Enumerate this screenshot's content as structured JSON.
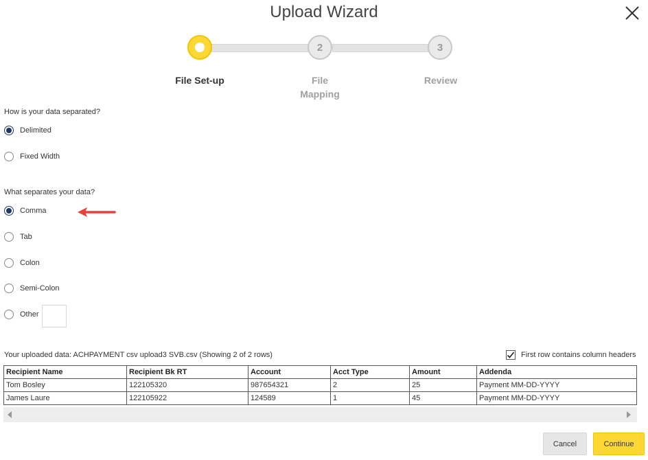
{
  "title": "Upload Wizard",
  "steps": [
    {
      "number": "",
      "label": "File Set-up",
      "state": "active"
    },
    {
      "number": "2",
      "label": "File\nMapping",
      "state": "inactive"
    },
    {
      "number": "3",
      "label": "Review",
      "state": "inactive"
    }
  ],
  "separation": {
    "question": "How is your data separated?",
    "options": [
      {
        "label": "Delimited",
        "selected": true
      },
      {
        "label": "Fixed Width",
        "selected": false
      }
    ]
  },
  "delimiter": {
    "question": "What separates your data?",
    "options": [
      {
        "label": "Comma",
        "selected": true
      },
      {
        "label": "Tab",
        "selected": false
      },
      {
        "label": "Colon",
        "selected": false
      },
      {
        "label": "Semi-Colon",
        "selected": false
      },
      {
        "label": "Other",
        "selected": false
      }
    ],
    "other_value": ""
  },
  "uploaded": {
    "prefix": "Your uploaded data:",
    "detail": "ACHPAYMENT csv upload3 SVB.csv (Showing 2 of 2 rows)",
    "header_checkbox_label": "First row contains column headers",
    "header_checkbox_checked": true
  },
  "table": {
    "columns": [
      "Recipient Name",
      "Recipient Bk RT",
      "Account",
      "Acct Type",
      "Amount",
      "Addenda"
    ],
    "rows": [
      [
        "Tom Bosley",
        "122105320",
        "987654321",
        "2",
        "25",
        "Payment MM-DD-YYYY"
      ],
      [
        "James Laure",
        "122105922",
        "124589",
        "1",
        "45",
        "Payment MM-DD-YYYY"
      ]
    ]
  },
  "buttons": {
    "cancel": "Cancel",
    "continue": "Continue"
  },
  "colors": {
    "accent": "#fdd835",
    "radio_selected": "#1f3864",
    "annotation_arrow": "#e8413c"
  }
}
